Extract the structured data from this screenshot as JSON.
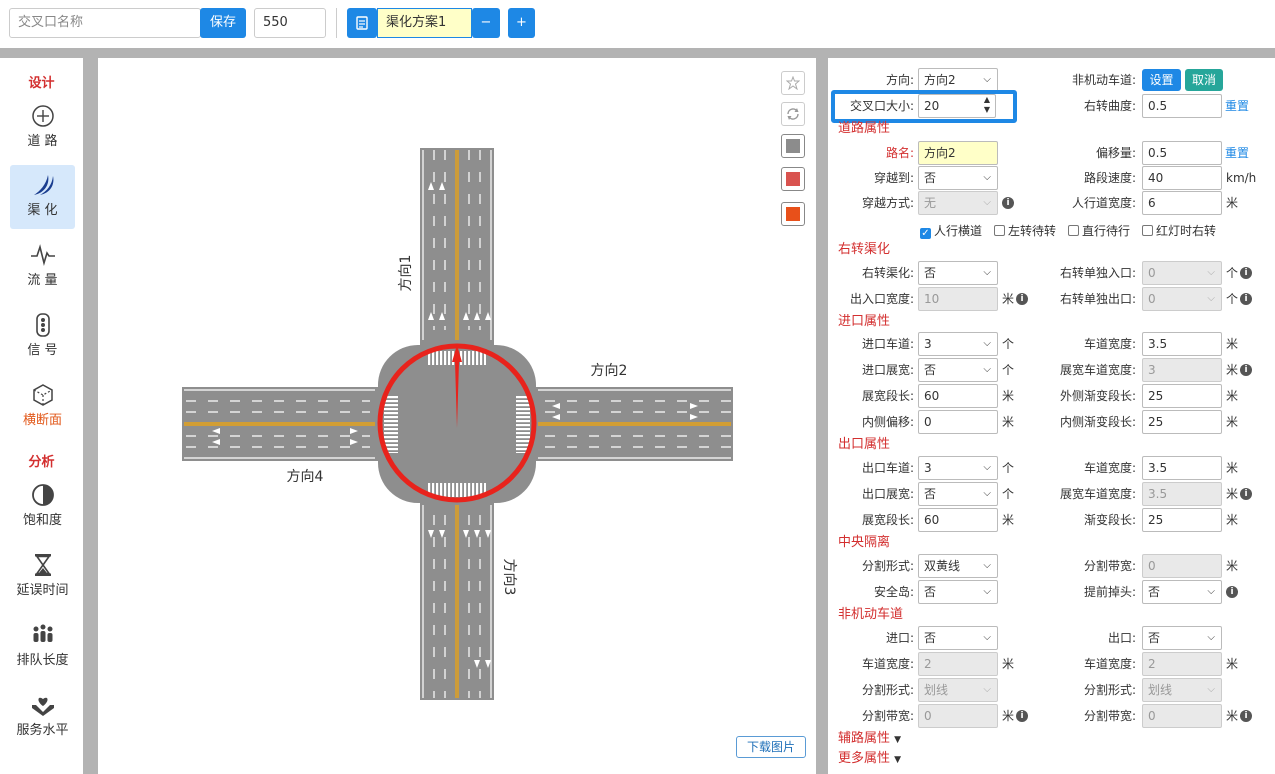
{
  "toolbar": {
    "name_placeholder": "交叉口名称",
    "save_label": "保存",
    "size_value": "550",
    "scheme_name": "渠化方案1",
    "minus_label": "−",
    "plus_label": "+"
  },
  "sidebar": {
    "design_title": "设计",
    "analysis_title": "分析",
    "design_items": [
      {
        "label": "道 路",
        "icon": "road-crosshair-icon"
      },
      {
        "label": "渠 化",
        "icon": "channelization-icon"
      },
      {
        "label": "流 量",
        "icon": "pulse-icon"
      },
      {
        "label": "信 号",
        "icon": "traffic-light-icon"
      },
      {
        "label": "横断面",
        "icon": "cube-icon"
      }
    ],
    "analysis_items": [
      {
        "label": "饱和度",
        "icon": "half-circle-icon"
      },
      {
        "label": "延误时间",
        "icon": "hourglass-icon"
      },
      {
        "label": "排队长度",
        "icon": "people-queue-icon"
      },
      {
        "label": "服务水平",
        "icon": "heart-hand-icon"
      }
    ]
  },
  "canvas": {
    "approach_labels": [
      "方向1",
      "方向2",
      "方向3",
      "方向4"
    ],
    "download_label": "下载图片",
    "swatch_colors": [
      "#8c8c8c",
      "#d9534f",
      "#e8501a"
    ],
    "highlight_color": "#e8231c"
  },
  "panel": {
    "direction_label": "方向:",
    "direction_value": "方向2",
    "nonmotor_label": "非机动车道:",
    "set_label": "设置",
    "cancel_label": "取消",
    "isize_label": "交叉口大小:",
    "isize_value": "20",
    "curvature_label": "右转曲度:",
    "curvature_value": "0.5",
    "reset_label": "重置",
    "road_title": "道路属性",
    "roadname_label": "路名:",
    "roadname_value": "方向2",
    "offset_label": "偏移量:",
    "offset_value": "0.5",
    "reset2_label": "重置",
    "cross_label": "穿越到:",
    "cross_value": "否",
    "speed_label": "路段速度:",
    "speed_value": "40",
    "speed_unit": "km/h",
    "crossmode_label": "穿越方式:",
    "crossmode_value": "无",
    "walkw_label": "人行道宽度:",
    "walkw_value": "6",
    "meter": "米",
    "ge": "个",
    "checks": [
      {
        "label": "人行横道",
        "checked": true
      },
      {
        "label": "左转待转",
        "checked": false
      },
      {
        "label": "直行待行",
        "checked": false
      },
      {
        "label": "红灯时右转",
        "checked": false
      }
    ],
    "rt_title": "右转渠化",
    "rt_label": "右转渠化:",
    "rt_value": "否",
    "rt_in_label": "右转单独入口:",
    "rt_in_value": "0",
    "io_width_label": "出入口宽度:",
    "io_width_value": "10",
    "rt_out_label": "右转单独出口:",
    "rt_out_value": "0",
    "entry_title": "进口属性",
    "entry_lanes_label": "进口车道:",
    "entry_lanes_value": "3",
    "lane_w_label": "车道宽度:",
    "lane_w_value": "3.5",
    "entry_widen_label": "进口展宽:",
    "entry_widen_value": "否",
    "widen_lane_w_label": "展宽车道宽度:",
    "widen_lane_w_value": "3",
    "widen_len_label": "展宽段长:",
    "widen_len_value": "60",
    "outer_taper_label": "外侧渐变段长:",
    "outer_taper_value": "25",
    "inner_offset_label": "内侧偏移:",
    "inner_offset_value": "0",
    "inner_taper_label": "内侧渐变段长:",
    "inner_taper_value": "25",
    "exit_title": "出口属性",
    "exit_lanes_label": "出口车道:",
    "exit_lanes_value": "3",
    "exit_lane_w_label": "车道宽度:",
    "exit_lane_w_value": "3.5",
    "exit_widen_label": "出口展宽:",
    "exit_widen_value": "否",
    "exit_widen_lane_w_label": "展宽车道宽度:",
    "exit_widen_lane_w_value": "3.5",
    "exit_widen_len_label": "展宽段长:",
    "exit_widen_len_value": "60",
    "exit_taper_label": "渐变段长:",
    "exit_taper_value": "25",
    "median_title": "中央隔离",
    "divide_form_label": "分割形式:",
    "divide_form_value": "双黄线",
    "divide_width_label": "分割带宽:",
    "divide_width_value": "0",
    "island_label": "安全岛:",
    "island_value": "否",
    "uturn_label": "提前掉头:",
    "uturn_value": "否",
    "nm_title": "非机动车道",
    "nm_in_label": "进口:",
    "nm_in_value": "否",
    "nm_out_label": "出口:",
    "nm_out_value": "否",
    "nm_lw_label": "车道宽度:",
    "nm_lw_value": "2",
    "nm_lw2_label": "车道宽度:",
    "nm_lw2_value": "2",
    "nm_form_label": "分割形式:",
    "nm_form_value": "划线",
    "nm_form2_label": "分割形式:",
    "nm_form2_value": "划线",
    "nm_width_label": "分割带宽:",
    "nm_width_value": "0",
    "nm_width2_label": "分割带宽:",
    "nm_width2_value": "0",
    "aux_title": "辅路属性",
    "more_title": "更多属性"
  }
}
